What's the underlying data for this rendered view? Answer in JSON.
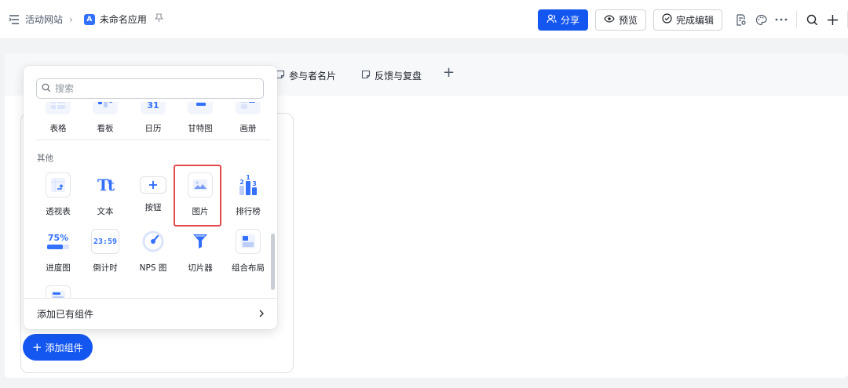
{
  "topbar": {
    "breadcrumb_site": "活动网站",
    "app_badge": "A",
    "app_name": "未命名应用",
    "share_label": "分享",
    "preview_label": "预览",
    "finish_label": "完成编辑"
  },
  "tabs": [
    {
      "label": "参与者名片"
    },
    {
      "label": "反馈与复盘"
    }
  ],
  "canvas": {
    "add_component_label": "添加组件"
  },
  "popover": {
    "search_placeholder": "搜索",
    "top_row": [
      {
        "label": "表格",
        "icon": "table-icon"
      },
      {
        "label": "看板",
        "icon": "kanban-icon"
      },
      {
        "label": "日历",
        "icon": "calendar-icon",
        "glyph": "31"
      },
      {
        "label": "甘特图",
        "icon": "gantt-icon"
      },
      {
        "label": "画册",
        "icon": "gallery-icon"
      }
    ],
    "section_other": "其他",
    "other_items": [
      {
        "label": "透视表",
        "icon": "pivot-table-icon"
      },
      {
        "label": "文本",
        "icon": "text-icon",
        "glyph": "Tt"
      },
      {
        "label": "按钮",
        "icon": "button-plus-icon",
        "glyph": "+"
      },
      {
        "label": "图片",
        "icon": "image-icon"
      },
      {
        "label": "排行榜",
        "icon": "leaderboard-icon",
        "glyph_top": "1",
        "glyph_left": "2",
        "glyph_right": "3"
      },
      {
        "label": "进度图",
        "icon": "progress-icon",
        "glyph": "75%"
      },
      {
        "label": "倒计时",
        "icon": "countdown-icon",
        "glyph": "23:59"
      },
      {
        "label": "NPS 图",
        "icon": "nps-gauge-icon"
      },
      {
        "label": "切片器",
        "icon": "slicer-filter-icon"
      },
      {
        "label": "组合布局",
        "icon": "combo-layout-icon"
      }
    ],
    "highlighted_item": "图片",
    "footer_label": "添加已有组件"
  },
  "colors": {
    "primary": "#1456f0",
    "highlight": "#e5484d",
    "icon_blue": "#3370ff"
  }
}
